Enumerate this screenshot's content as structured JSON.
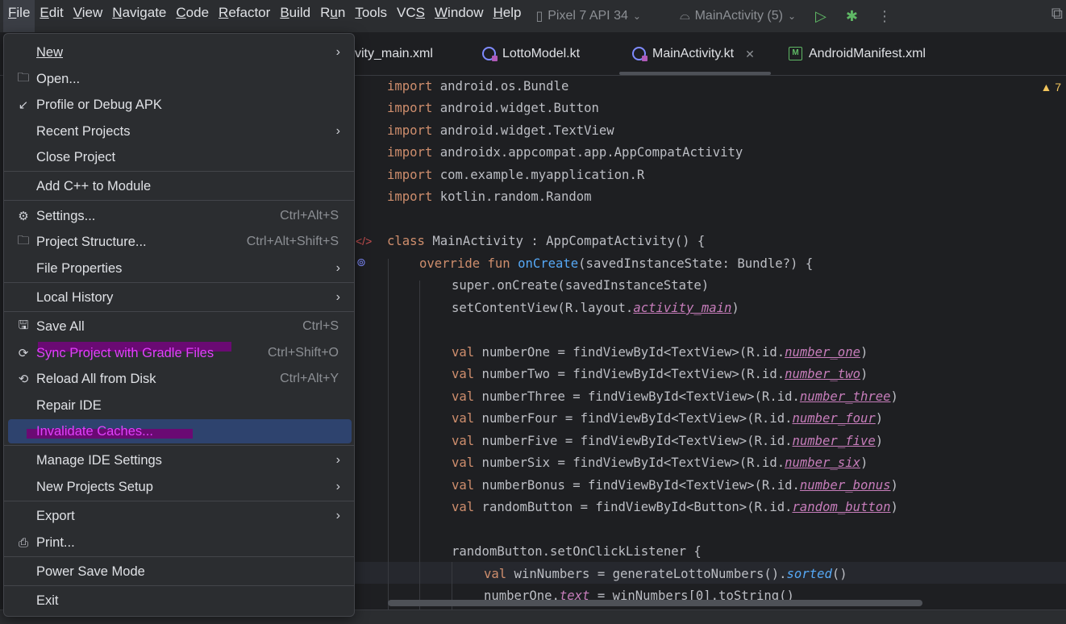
{
  "menubar": {
    "items": [
      {
        "label": "File",
        "mnemonic": "F",
        "rest": "ile"
      },
      {
        "label": "Edit",
        "mnemonic": "E",
        "rest": "dit"
      },
      {
        "label": "View",
        "mnemonic": "V",
        "rest": "iew"
      },
      {
        "label": "Navigate",
        "mnemonic": "N",
        "rest": "avigate"
      },
      {
        "label": "Code",
        "mnemonic": "C",
        "rest": "ode"
      },
      {
        "label": "Refactor",
        "mnemonic": "R",
        "rest": "efactor"
      },
      {
        "label": "Build",
        "mnemonic": "B",
        "rest": "uild"
      },
      {
        "label": "Run",
        "mnemonic": "u",
        "pre": "R",
        "rest": "n"
      },
      {
        "label": "Tools",
        "mnemonic": "T",
        "rest": "ools"
      },
      {
        "label": "VCS",
        "mnemonic": "S",
        "pre": "VC",
        "rest": ""
      },
      {
        "label": "Window",
        "mnemonic": "W",
        "rest": "indow"
      },
      {
        "label": "Help",
        "mnemonic": "H",
        "rest": "elp"
      }
    ],
    "device": "Pixel 7 API 34",
    "run_config": "MainActivity (5)"
  },
  "tabs": [
    {
      "label": "activity_main.xml",
      "visible_text": "vity_main.xml"
    },
    {
      "label": "LottoModel.kt"
    },
    {
      "label": "MainActivity.kt",
      "active": true
    },
    {
      "label": "AndroidManifest.xml"
    }
  ],
  "editor": {
    "warning_count": "7",
    "lines": {
      "l1": {
        "kw": "import",
        "rest": " android.os.Bundle"
      },
      "l2": {
        "kw": "import",
        "rest": " android.widget.Button"
      },
      "l3": {
        "kw": "import",
        "rest": " android.widget.TextView"
      },
      "l4": {
        "kw": "import",
        "rest": " androidx.appcompat.app.AppCompatActivity"
      },
      "l5": {
        "kw": "import",
        "rest": " com.example.myapplication.R"
      },
      "l6": {
        "kw": "import",
        "rest": " kotlin.random.Random"
      },
      "l8": {
        "kw": "class",
        "rest": " MainActivity : AppCompatActivity() {"
      },
      "l9": {
        "kw": "override fun",
        "fn": "onCreate",
        "rest": "(savedInstanceState: Bundle?) {"
      },
      "l10": {
        "text": "super.onCreate(savedInstanceState)"
      },
      "l11": {
        "pre": "setContentView(R.layout.",
        "prop": "activity_main",
        "post": ")"
      },
      "l13": {
        "kw": "val",
        "mid": " numberOne = findViewById<TextView>(R.id.",
        "prop": "number_one",
        "post": ")"
      },
      "l14": {
        "kw": "val",
        "mid": " numberTwo = findViewById<TextView>(R.id.",
        "prop": "number_two",
        "post": ")"
      },
      "l15": {
        "kw": "val",
        "mid": " numberThree = findViewById<TextView>(R.id.",
        "prop": "number_three",
        "post": ")"
      },
      "l16": {
        "kw": "val",
        "mid": " numberFour = findViewById<TextView>(R.id.",
        "prop": "number_four",
        "post": ")"
      },
      "l17": {
        "kw": "val",
        "mid": " numberFive = findViewById<TextView>(R.id.",
        "prop": "number_five",
        "post": ")"
      },
      "l18": {
        "kw": "val",
        "mid": " numberSix = findViewById<TextView>(R.id.",
        "prop": "number_six",
        "post": ")"
      },
      "l19": {
        "kw": "val",
        "mid": " numberBonus = findViewById<TextView>(R.id.",
        "prop": "number_bonus",
        "post": ")"
      },
      "l20": {
        "kw": "val",
        "mid": " randomButton = findViewById<Button>(R.id.",
        "prop": "random_button",
        "post": ")"
      },
      "l22": {
        "text": "randomButton.setOnClickListener {"
      },
      "l23": {
        "kw": "val",
        "mid": " winNumbers = generateLottoNumbers().",
        "ital": "sorted",
        "post": "()"
      },
      "l24": {
        "pre": "numberOne.",
        "prop": "text",
        "post": " = winNumbers[0].toString()"
      }
    }
  },
  "file_menu": {
    "new": "New",
    "open": "Open...",
    "profile_debug_apk": "Profile or Debug APK",
    "recent_projects": "Recent Projects",
    "close_project": "Close Project",
    "add_cpp": "Add C++ to Module",
    "settings": "Settings...",
    "settings_shortcut": "Ctrl+Alt+S",
    "project_structure": "Project Structure...",
    "project_structure_shortcut": "Ctrl+Alt+Shift+S",
    "file_properties": "File Properties",
    "local_history": "Local History",
    "save_all": "Save All",
    "save_all_shortcut": "Ctrl+S",
    "sync_gradle": "Sync Project with Gradle Files",
    "sync_gradle_shortcut": "Ctrl+Shift+O",
    "reload_disk": "Reload All from Disk",
    "reload_disk_shortcut": "Ctrl+Alt+Y",
    "repair_ide": "Repair IDE",
    "invalidate_caches": "Invalidate Caches...",
    "manage_ide_settings": "Manage IDE Settings",
    "new_projects_setup": "New Projects Setup",
    "export": "Export",
    "print": "Print...",
    "power_save_mode": "Power Save Mode",
    "exit": "Exit"
  },
  "colors": {
    "highlight": "#2e436e",
    "annotation_mark": "#6a0a73",
    "annotation_text": "#e040fb"
  }
}
